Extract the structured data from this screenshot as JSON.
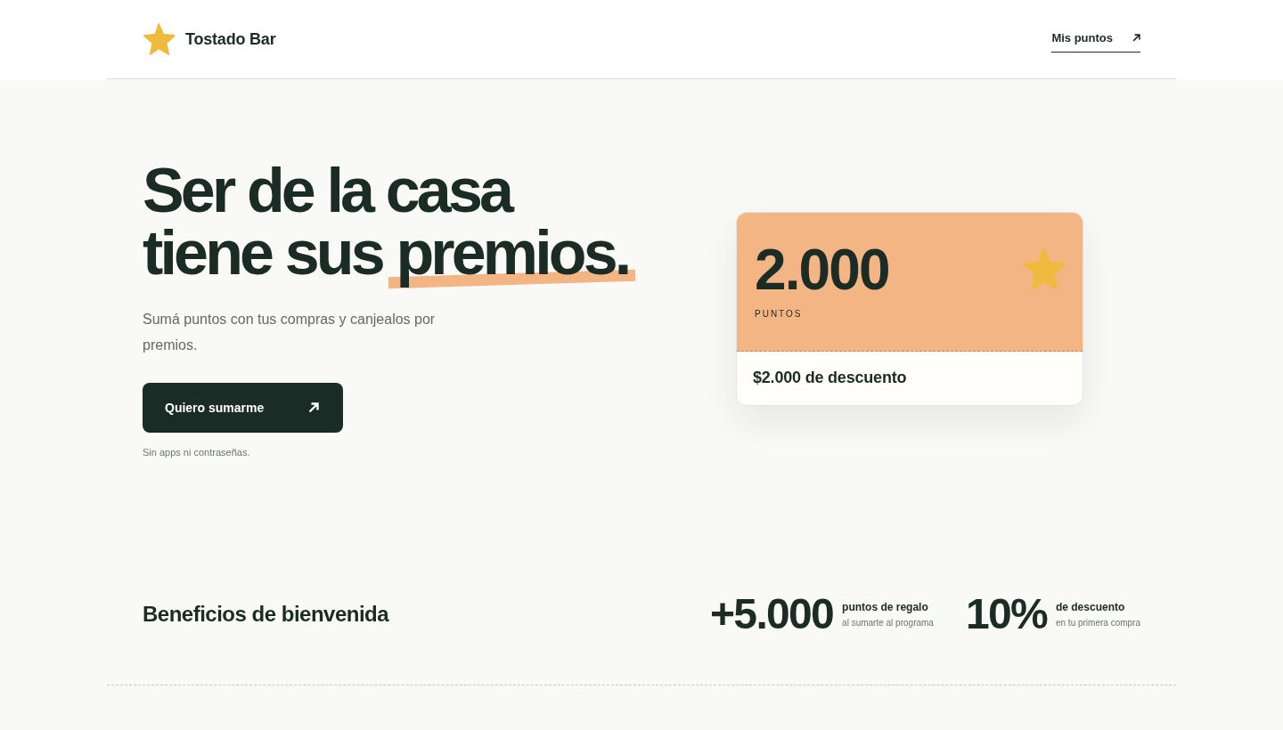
{
  "header": {
    "brand": "Tostado Bar",
    "link": "Mis puntos"
  },
  "hero": {
    "headline": {
      "text": "Ser de la casa tiene sus",
      "highlight": "premios."
    },
    "subtitle": "Sumá puntos con tus compras y canjealos por premios.",
    "button": "Quiero sumarme",
    "note": "Sin apps ni contraseñas."
  },
  "points_card": {
    "value": "2.000",
    "unit": "PUNTOS",
    "reward": "$2.000 de descuento"
  },
  "benefits": {
    "title": "Beneficios de bienvenida",
    "items": [
      {
        "value": "+5.000",
        "label": "puntos de regalo",
        "detail": "al sumarte al programa"
      },
      {
        "value": "10%",
        "label": "de descuento",
        "detail": "en tu primera compra"
      }
    ]
  }
}
